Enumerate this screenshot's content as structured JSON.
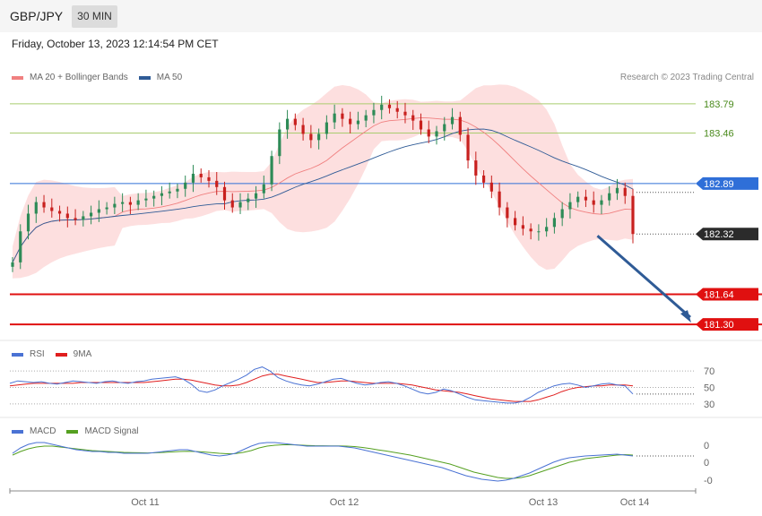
{
  "header": {
    "pair": "GBP/JPY",
    "timeframe": "30 MIN",
    "datetime": "Friday, October 13, 2023 12:14:54 PM CET",
    "credit": "Research © 2023 Trading Central"
  },
  "chart_data": [
    {
      "type": "candlestick",
      "title": "GBP/JPY",
      "timeframe": "30 MIN",
      "legend": [
        {
          "name": "MA 20 + Bollinger Bands",
          "color": "#f08080"
        },
        {
          "name": "MA 50",
          "color": "#2f5b96"
        }
      ],
      "x_ticks": [
        "Oct 11",
        "Oct 12",
        "Oct 13",
        "Oct 14"
      ],
      "ylim": [
        181.2,
        183.95
      ],
      "levels": [
        {
          "label": "183.79",
          "value": 183.79,
          "style": "support-resistance-green"
        },
        {
          "label": "183.46",
          "value": 183.46,
          "style": "support-resistance-green"
        },
        {
          "label": "182.89",
          "value": 182.89,
          "style": "pivot-blue"
        },
        {
          "label": "182.32",
          "value": 182.32,
          "style": "last-price"
        },
        {
          "label": "181.64",
          "value": 181.64,
          "style": "target-red"
        },
        {
          "label": "181.30",
          "value": 181.3,
          "style": "target-red"
        }
      ],
      "arrow": {
        "from": [
          0.94,
          182.3
        ],
        "to": [
          1.0,
          181.32
        ],
        "direction": "down"
      },
      "closes": [
        182.0,
        182.35,
        182.55,
        182.68,
        182.62,
        182.58,
        182.55,
        182.5,
        182.48,
        182.52,
        182.56,
        182.6,
        182.62,
        182.66,
        182.68,
        182.65,
        182.7,
        182.72,
        182.75,
        182.78,
        182.8,
        182.83,
        182.9,
        183.0,
        182.96,
        182.92,
        182.85,
        182.7,
        182.62,
        182.68,
        182.72,
        182.78,
        182.88,
        183.2,
        183.5,
        183.62,
        183.55,
        183.45,
        183.38,
        183.45,
        183.58,
        183.68,
        183.62,
        183.56,
        183.6,
        183.66,
        183.72,
        183.78,
        183.74,
        183.7,
        183.66,
        183.6,
        183.5,
        183.42,
        183.48,
        183.56,
        183.64,
        183.44,
        183.15,
        182.98,
        182.9,
        182.8,
        182.62,
        182.5,
        182.42,
        182.38,
        182.35,
        182.35,
        182.4,
        182.5,
        182.6,
        182.68,
        182.74,
        182.7,
        182.65,
        182.7,
        182.78,
        182.84,
        182.75,
        182.32
      ]
    },
    {
      "type": "line",
      "title": "RSI",
      "series": [
        {
          "name": "RSI",
          "color": "#4a72d4"
        },
        {
          "name": "9MA",
          "color": "#e01e1e"
        }
      ],
      "y_ticks": [
        70,
        50,
        30
      ],
      "ylim": [
        20,
        80
      ],
      "rsi": [
        55,
        58,
        57,
        56,
        57,
        55,
        54,
        56,
        58,
        57,
        56,
        55,
        57,
        58,
        56,
        55,
        57,
        58,
        60,
        61,
        62,
        63,
        60,
        54,
        46,
        44,
        47,
        52,
        56,
        60,
        65,
        72,
        75,
        70,
        62,
        58,
        55,
        53,
        52,
        54,
        57,
        60,
        61,
        58,
        55,
        53,
        54,
        56,
        57,
        55,
        52,
        48,
        44,
        42,
        44,
        48,
        46,
        42,
        38,
        35,
        34,
        33,
        32,
        31,
        31,
        33,
        38,
        44,
        48,
        52,
        54,
        55,
        53,
        50,
        52,
        54,
        55,
        53,
        52,
        42
      ],
      "ma9": [
        52,
        53,
        54,
        55,
        55,
        55,
        55,
        55,
        55,
        56,
        56,
        56,
        56,
        56,
        56,
        56,
        56,
        56,
        57,
        58,
        59,
        60,
        60,
        59,
        57,
        55,
        53,
        52,
        52,
        53,
        56,
        60,
        64,
        66,
        66,
        64,
        62,
        60,
        58,
        56,
        56,
        57,
        58,
        58,
        57,
        56,
        55,
        55,
        55,
        55,
        54,
        53,
        51,
        49,
        47,
        46,
        45,
        44,
        42,
        40,
        38,
        36,
        35,
        34,
        33,
        33,
        33,
        35,
        38,
        41,
        45,
        48,
        50,
        51,
        52,
        52,
        53,
        53,
        53,
        52
      ]
    },
    {
      "type": "line",
      "title": "MACD",
      "series": [
        {
          "name": "MACD",
          "color": "#4a72d4"
        },
        {
          "name": "MACD Signal",
          "color": "#55a020"
        }
      ],
      "y_ticks": [
        "0",
        "0",
        "-0"
      ],
      "macd": [
        0.02,
        0.08,
        0.12,
        0.14,
        0.14,
        0.12,
        0.1,
        0.08,
        0.06,
        0.05,
        0.04,
        0.04,
        0.03,
        0.03,
        0.02,
        0.02,
        0.02,
        0.02,
        0.03,
        0.04,
        0.05,
        0.06,
        0.06,
        0.04,
        0.02,
        0.0,
        -0.01,
        0.0,
        0.02,
        0.06,
        0.1,
        0.13,
        0.14,
        0.14,
        0.13,
        0.12,
        0.11,
        0.1,
        0.1,
        0.1,
        0.1,
        0.1,
        0.09,
        0.08,
        0.06,
        0.04,
        0.02,
        0.0,
        -0.02,
        -0.04,
        -0.06,
        -0.08,
        -0.1,
        -0.12,
        -0.14,
        -0.17,
        -0.2,
        -0.23,
        -0.25,
        -0.27,
        -0.28,
        -0.29,
        -0.28,
        -0.26,
        -0.23,
        -0.2,
        -0.16,
        -0.12,
        -0.08,
        -0.05,
        -0.03,
        -0.02,
        -0.01,
        -0.005,
        0.0,
        0.005,
        0.01,
        0.0,
        -0.01
      ],
      "signal": [
        0.0,
        0.04,
        0.07,
        0.09,
        0.1,
        0.1,
        0.09,
        0.08,
        0.07,
        0.06,
        0.05,
        0.045,
        0.04,
        0.035,
        0.03,
        0.028,
        0.026,
        0.024,
        0.026,
        0.03,
        0.035,
        0.04,
        0.042,
        0.04,
        0.035,
        0.028,
        0.02,
        0.015,
        0.016,
        0.03,
        0.05,
        0.08,
        0.1,
        0.11,
        0.115,
        0.115,
        0.112,
        0.108,
        0.105,
        0.104,
        0.103,
        0.102,
        0.1,
        0.095,
        0.085,
        0.072,
        0.058,
        0.045,
        0.03,
        0.015,
        0.0,
        -0.02,
        -0.04,
        -0.06,
        -0.08,
        -0.1,
        -0.13,
        -0.16,
        -0.19,
        -0.21,
        -0.23,
        -0.25,
        -0.26,
        -0.26,
        -0.25,
        -0.23,
        -0.2,
        -0.17,
        -0.14,
        -0.11,
        -0.08,
        -0.06,
        -0.04,
        -0.03,
        -0.02,
        -0.01,
        0.0,
        0.005,
        0.0
      ]
    }
  ],
  "legends": {
    "main": {
      "ma20": "MA 20 + Bollinger Bands",
      "ma50": "MA 50"
    },
    "rsi": {
      "rsi": "RSI",
      "ma9": "9MA"
    },
    "macd": {
      "macd": "MACD",
      "signal": "MACD Signal"
    }
  },
  "colors": {
    "bull": "#2e8b57",
    "bear": "#c8201e",
    "bands": "#fcd4d4",
    "ma20": "#f08080",
    "ma50": "#2f5b96",
    "green_level": "#a8cc6e",
    "blue_level": "#2f6fd8",
    "red_level": "#e01010",
    "arrow": "#2f5b96"
  }
}
